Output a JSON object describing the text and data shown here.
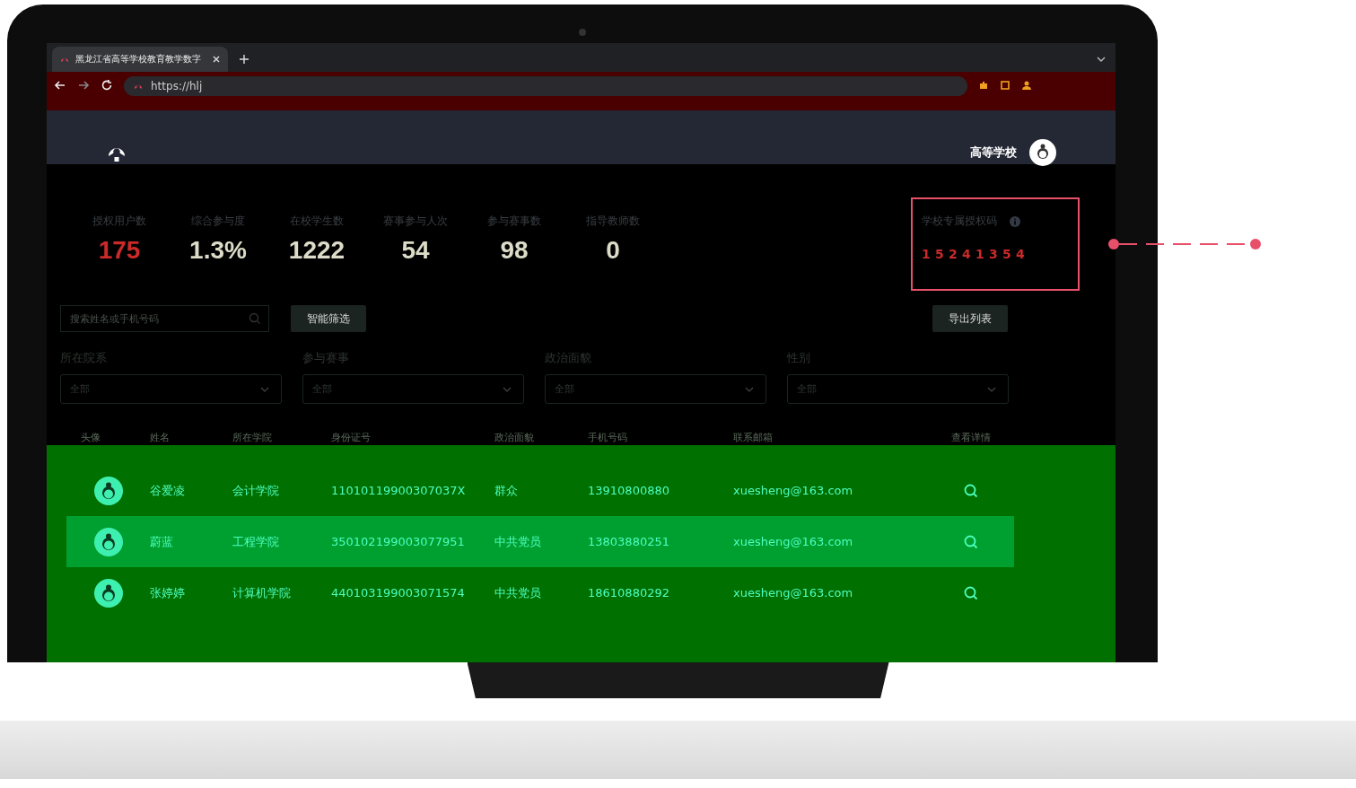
{
  "browser": {
    "tab_title": "黑龙江省高等学校教育教学数字",
    "url": "https://hlj"
  },
  "header": {
    "school": "高等学校"
  },
  "stats": [
    {
      "label": "授权用户数",
      "value": "175",
      "highlight": true
    },
    {
      "label": "综合参与度",
      "value": "1.3%",
      "highlight": false
    },
    {
      "label": "在校学生数",
      "value": "1222",
      "highlight": false
    },
    {
      "label": "赛事参与人次",
      "value": "54",
      "highlight": false
    },
    {
      "label": "参与赛事数",
      "value": "98",
      "highlight": false
    },
    {
      "label": "指导教师数",
      "value": "0",
      "highlight": false
    }
  ],
  "auth_code": {
    "label": "学校专属授权码",
    "digits": [
      "1",
      "5",
      "2",
      "4",
      "1",
      "3",
      "5",
      "4"
    ]
  },
  "search": {
    "placeholder": "搜索姓名或手机号码"
  },
  "buttons": {
    "filter": "智能筛选",
    "export": "导出列表"
  },
  "filters": [
    {
      "label": "所在院系",
      "value": "全部"
    },
    {
      "label": "参与赛事",
      "value": "全部"
    },
    {
      "label": "政治面貌",
      "value": "全部"
    },
    {
      "label": "性别",
      "value": "全部"
    }
  ],
  "table": {
    "columns": [
      "头像",
      "姓名",
      "所在学院",
      "身份证号",
      "政治面貌",
      "手机号码",
      "联系邮箱",
      "查看详情"
    ],
    "rows": [
      {
        "name": "谷爱凌",
        "college": "会计学院",
        "id": "11010119900307037X",
        "politics": "群众",
        "phone": "13910800880",
        "email": "xuesheng@163.com",
        "selected": false
      },
      {
        "name": "蔚蓝",
        "college": "工程学院",
        "id": "350102199003077951",
        "politics": "中共党员",
        "phone": "13803880251",
        "email": "xuesheng@163.com",
        "selected": true
      },
      {
        "name": "张婷婷",
        "college": "计算机学院",
        "id": "440103199003071574",
        "politics": "中共党员",
        "phone": "18610880292",
        "email": "xuesheng@163.com",
        "selected": false
      }
    ]
  }
}
